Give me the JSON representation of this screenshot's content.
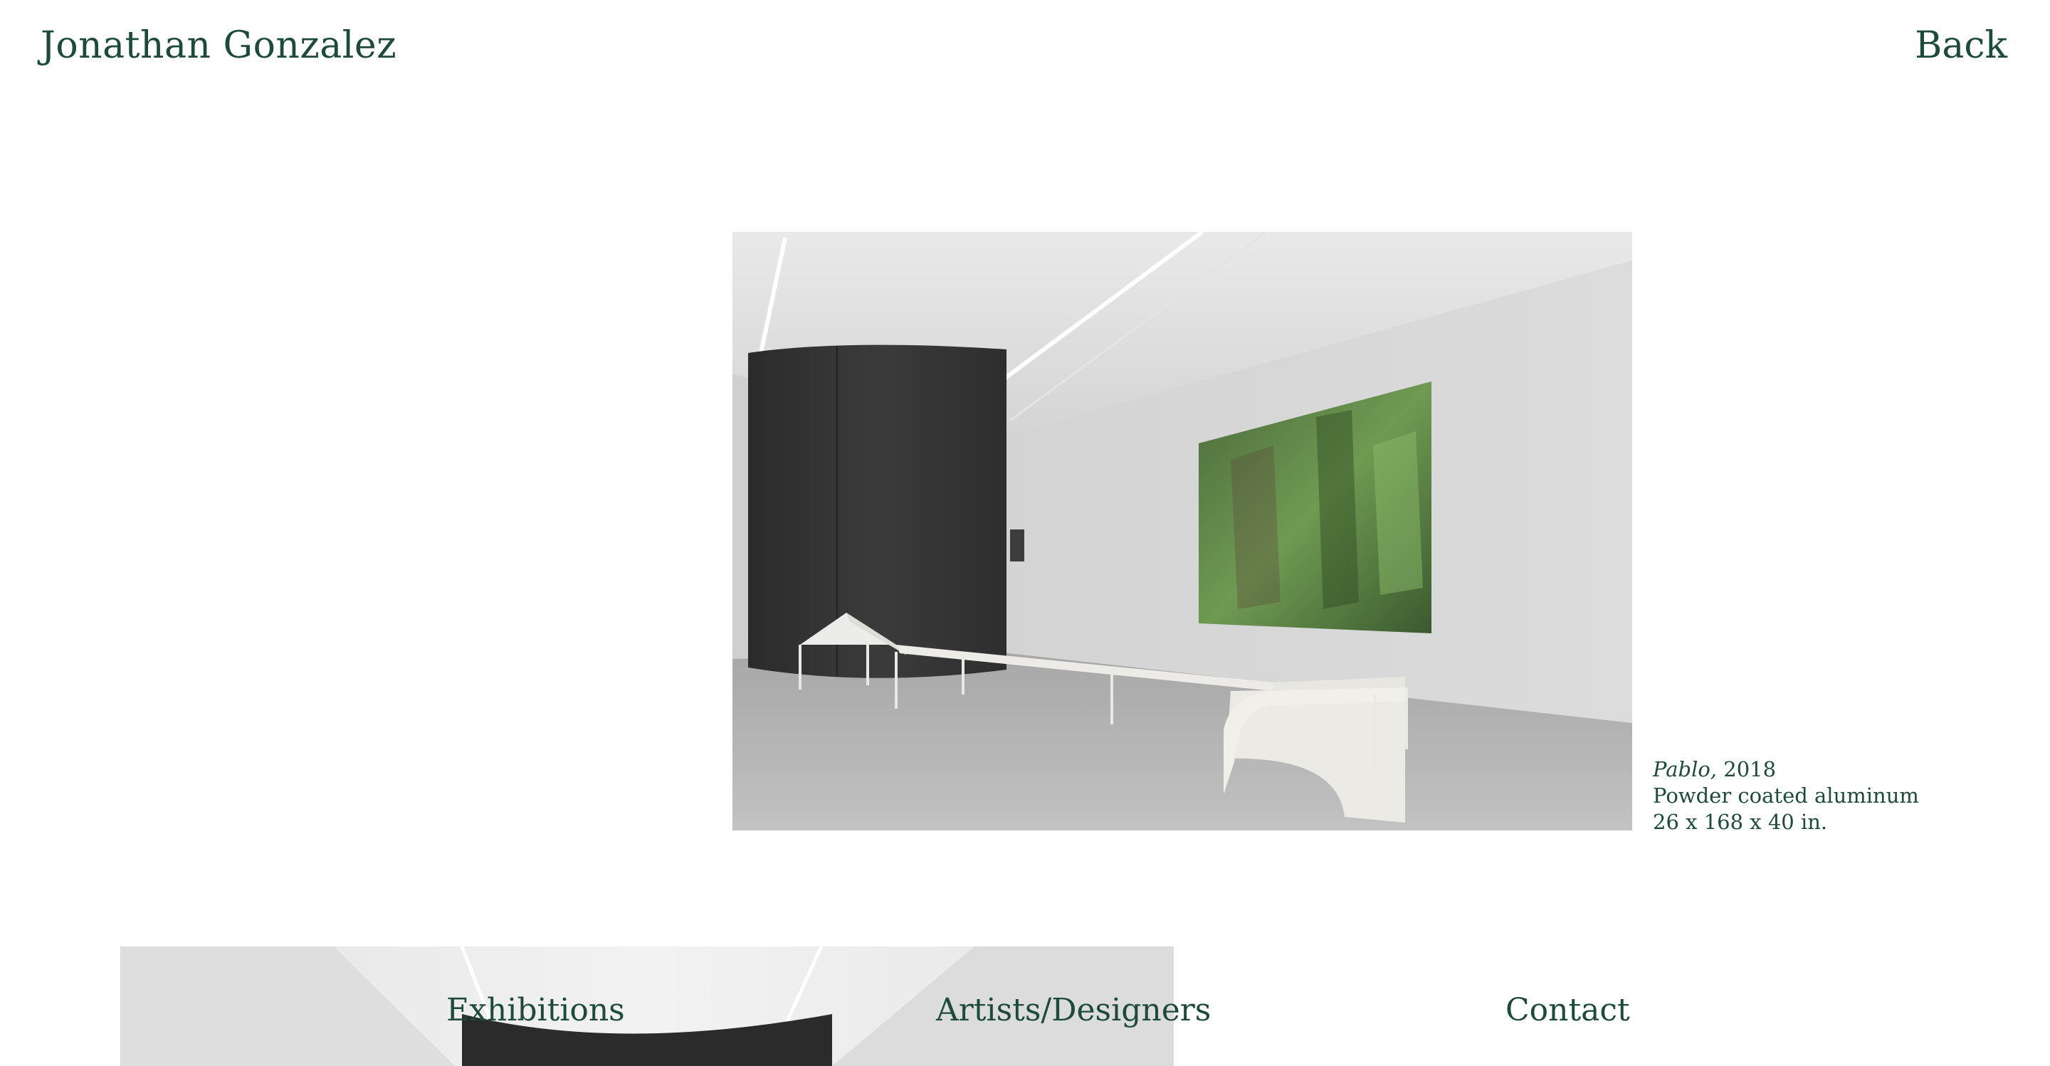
{
  "header": {
    "site_title": "Jonathan Gonzalez",
    "back_label": "Back"
  },
  "artwork": {
    "image_alt": "Installation view: long white bench sculpture in a gallery with a black cylindrical wall and a jungle painting",
    "caption": {
      "title": "Pablo,",
      "year": " 2018",
      "material": "Powder coated  aluminum",
      "dimensions": "26 x 168 x 40 in."
    }
  },
  "footer_nav": {
    "items": [
      {
        "label": "Exhibitions"
      },
      {
        "label": "Artists/Designers"
      },
      {
        "label": "Contact"
      }
    ]
  },
  "colors": {
    "text": "#1e4a3c",
    "background": "#ffffff"
  }
}
